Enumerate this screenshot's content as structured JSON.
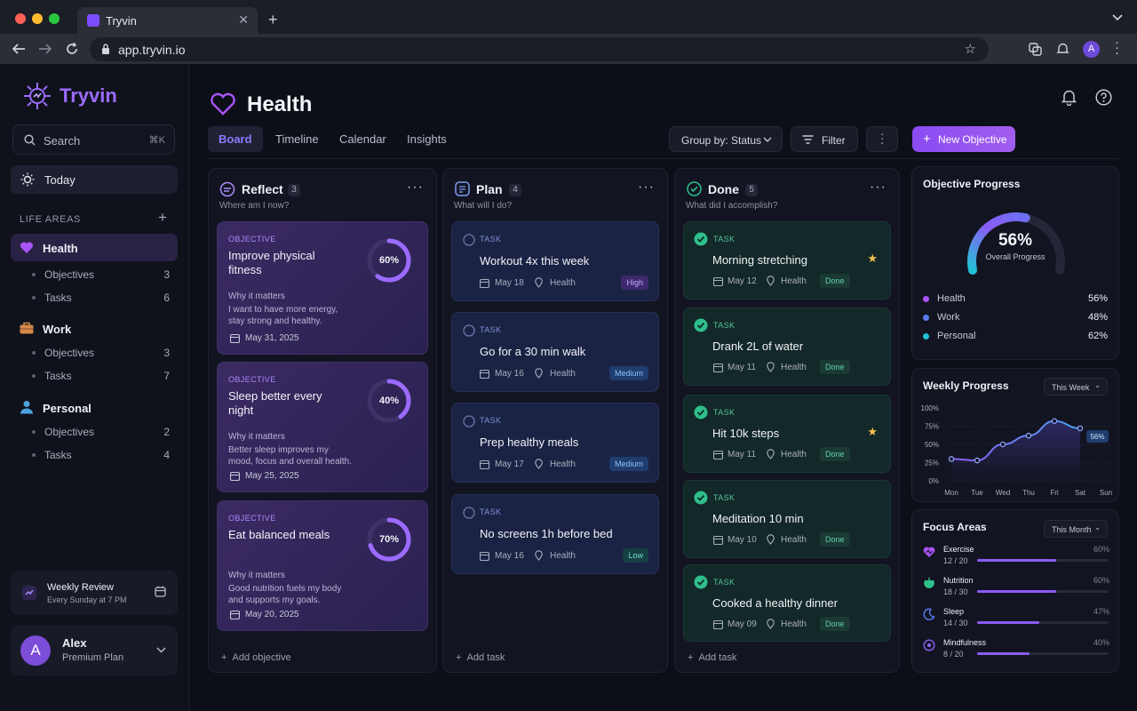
{
  "browser": {
    "tab_title": "Tryvin",
    "url": "app.tryvin.io",
    "avatar_initial": "A"
  },
  "sidebar": {
    "brand": "Tryvin",
    "search_label": "Search",
    "search_shortcut": "⌘K",
    "today_label": "Today",
    "section_label": "LIFE AREAS",
    "areas": [
      {
        "name": "Health",
        "objectives_label": "Objectives",
        "objectives_count": "3",
        "tasks_label": "Tasks",
        "tasks_count": "6",
        "color": "#a855f7"
      },
      {
        "name": "Work",
        "objectives_label": "Objectives",
        "objectives_count": "3",
        "tasks_label": "Tasks",
        "tasks_count": "7",
        "color": "#d4894a"
      },
      {
        "name": "Personal",
        "objectives_label": "Objectives",
        "objectives_count": "2",
        "tasks_label": "Tasks",
        "tasks_count": "4",
        "color": "#4aa3e0"
      }
    ],
    "weekly_review": {
      "title": "Weekly Review",
      "subtitle": "Every Sunday at 7 PM"
    },
    "user": {
      "initial": "A",
      "name": "Alex",
      "plan": "Premium Plan"
    }
  },
  "header": {
    "title": "Health",
    "tabs": [
      "Board",
      "Timeline",
      "Calendar",
      "Insights"
    ],
    "active_tab": "Board",
    "group_by": "Group by: Status",
    "filter": "Filter",
    "new_objective": "New Objective"
  },
  "columns": {
    "reflect": {
      "title": "Reflect",
      "count": "3",
      "subtitle": "Where am I now?",
      "add_label": "Add objective",
      "cards": [
        {
          "kicker": "OBJECTIVE",
          "title": "Improve physical fitness",
          "progress": 60,
          "progress_label": "60%",
          "why_label": "Why it matters",
          "why": "I want to have more energy, stay strong and healthy.",
          "date": "May 31, 2025"
        },
        {
          "kicker": "OBJECTIVE",
          "title": "Sleep better every night",
          "progress": 40,
          "progress_label": "40%",
          "why_label": "Why it matters",
          "why": "Better sleep improves my mood, focus and overall health.",
          "date": "May 25, 2025"
        },
        {
          "kicker": "OBJECTIVE",
          "title": "Eat balanced meals",
          "progress": 70,
          "progress_label": "70%",
          "why_label": "Why it matters",
          "why": "Good nutrition fuels my body and supports my goals.",
          "date": "May 20, 2025"
        }
      ]
    },
    "plan": {
      "title": "Plan",
      "count": "4",
      "subtitle": "What will I do?",
      "add_label": "Add task",
      "cards": [
        {
          "kicker": "TASK",
          "title": "Workout 4x this week",
          "date": "May 18",
          "area": "Health",
          "priority": "High"
        },
        {
          "kicker": "TASK",
          "title": "Go for a 30 min walk",
          "date": "May 16",
          "area": "Health",
          "priority": "Medium"
        },
        {
          "kicker": "TASK",
          "title": "Prep healthy meals",
          "date": "May 17",
          "area": "Health",
          "priority": "Medium"
        },
        {
          "kicker": "TASK",
          "title": "No screens 1h before bed",
          "date": "May 16",
          "area": "Health",
          "priority": "Low"
        }
      ]
    },
    "done": {
      "title": "Done",
      "count": "5",
      "subtitle": "What did I accomplish?",
      "add_label": "Add task",
      "cards": [
        {
          "kicker": "TASK",
          "title": "Morning stretching",
          "date": "May 12",
          "area": "Health",
          "status": "Done",
          "starred": true
        },
        {
          "kicker": "TASK",
          "title": "Drank 2L of water",
          "date": "May 11",
          "area": "Health",
          "status": "Done",
          "starred": false
        },
        {
          "kicker": "TASK",
          "title": "Hit 10k steps",
          "date": "May 11",
          "area": "Health",
          "status": "Done",
          "starred": true
        },
        {
          "kicker": "TASK",
          "title": "Meditation 10 min",
          "date": "May 10",
          "area": "Health",
          "status": "Done",
          "starred": false
        },
        {
          "kicker": "TASK",
          "title": "Cooked a healthy dinner",
          "date": "May 09",
          "area": "Health",
          "status": "Done",
          "starred": false
        }
      ]
    }
  },
  "objective_progress": {
    "title": "Objective Progress",
    "value": 56,
    "value_label": "56%",
    "caption": "Overall Progress",
    "rows": [
      {
        "label": "Health",
        "value": "56%",
        "color": "#a855f7"
      },
      {
        "label": "Work",
        "value": "48%",
        "color": "#5b7cf0"
      },
      {
        "label": "Personal",
        "value": "62%",
        "color": "#22c1d6"
      }
    ]
  },
  "weekly_progress": {
    "title": "Weekly Progress",
    "range": "This Week",
    "current_label": "56%"
  },
  "chart_data": {
    "type": "area",
    "title": "Weekly Progress",
    "categories": [
      "Mon",
      "Tue",
      "Wed",
      "Thu",
      "Fri",
      "Sat",
      "Sun"
    ],
    "y_ticks": [
      "0%",
      "25%",
      "50%",
      "75%",
      "100%"
    ],
    "ylim": [
      0,
      100
    ],
    "values": [
      30,
      28,
      50,
      62,
      82,
      72,
      null
    ]
  },
  "focus_areas": {
    "title": "Focus Areas",
    "range": "This Month",
    "items": [
      {
        "name": "Exercise",
        "count": "12 / 20",
        "pct": "60%",
        "value": 60,
        "icon": "exercise-icon"
      },
      {
        "name": "Nutrition",
        "count": "18 / 30",
        "pct": "60%",
        "value": 60,
        "icon": "nutrition-icon"
      },
      {
        "name": "Sleep",
        "count": "14 / 30",
        "pct": "47%",
        "value": 47,
        "icon": "moon-icon"
      },
      {
        "name": "Mindfulness",
        "count": "8 / 20",
        "pct": "40%",
        "value": 40,
        "icon": "mindfulness-icon"
      }
    ]
  },
  "colors": {
    "accent": "#8b5cf6",
    "done": "#2fbf8c",
    "star": "#f5c14b"
  }
}
